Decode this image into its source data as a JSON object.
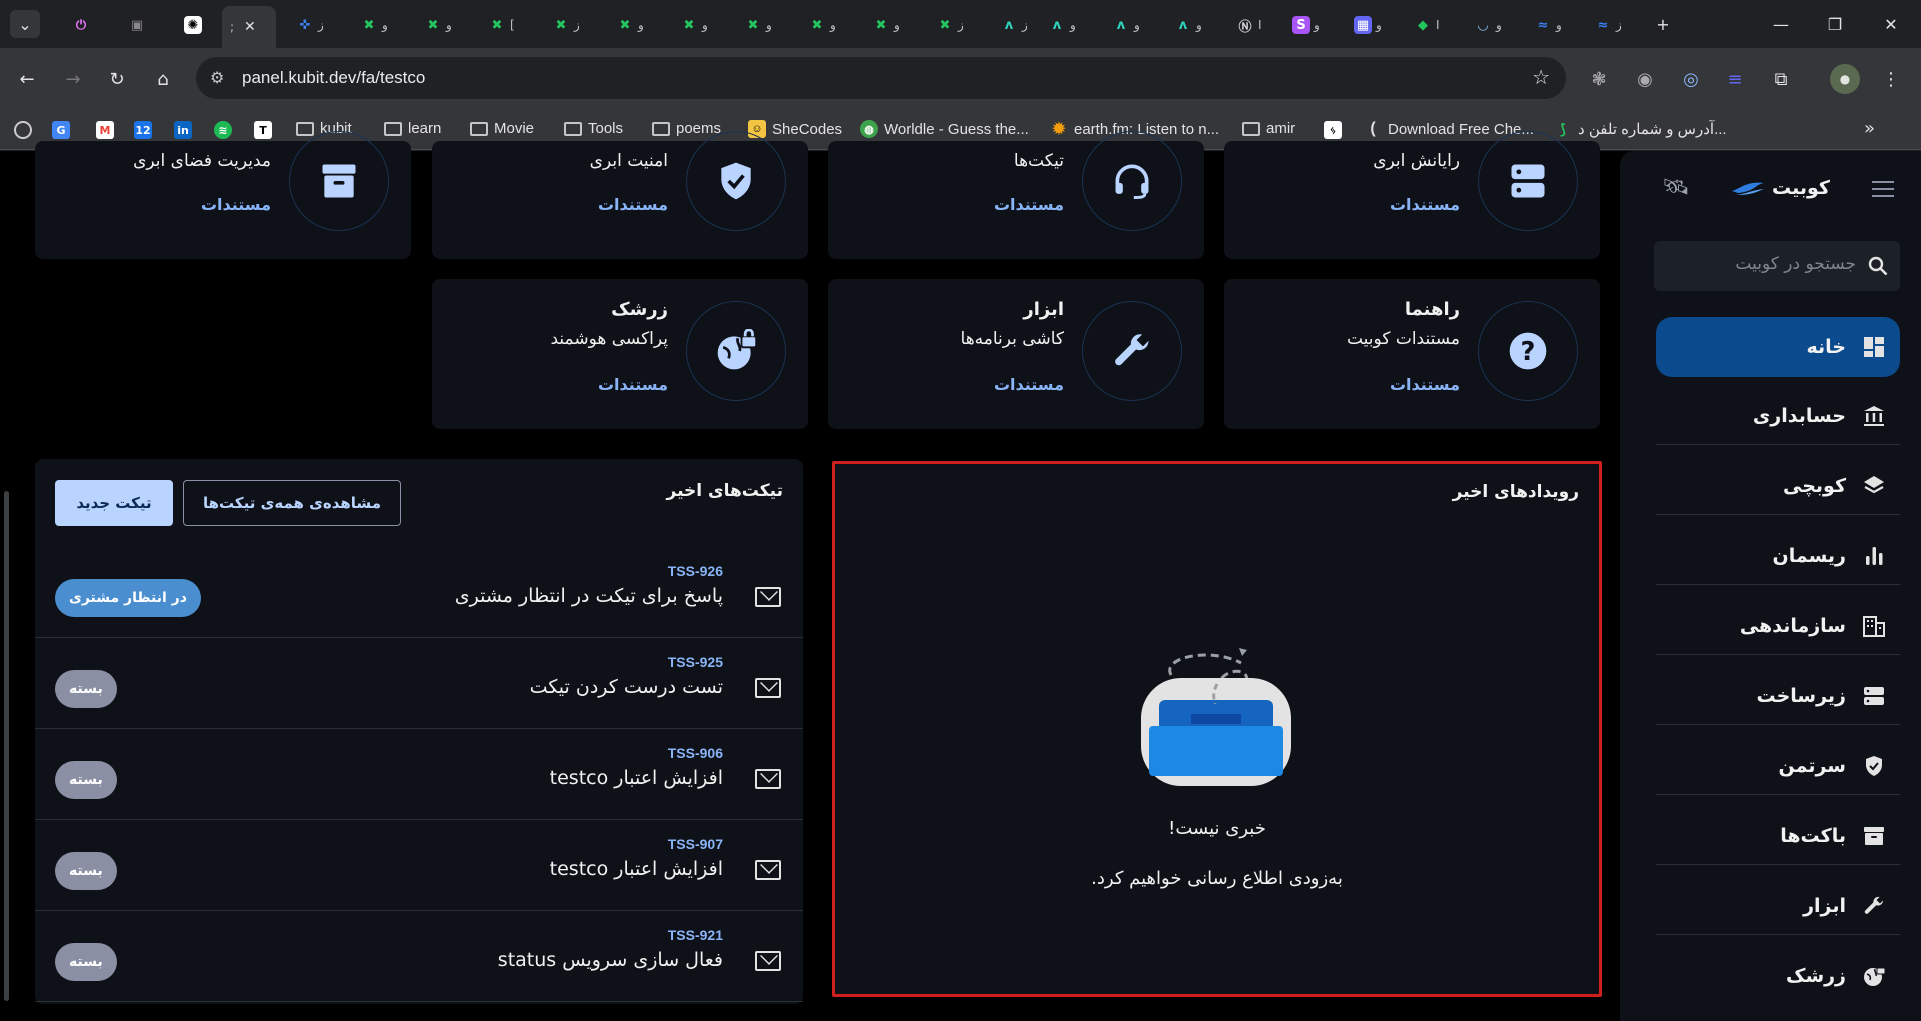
{
  "browser": {
    "url": "panel.kubit.dev/fa/testco",
    "active_tab_label": ";",
    "tab_labels": [
      "",
      "",
      ";",
      "ز",
      "و",
      "و",
      "[",
      "ز",
      "و",
      "و",
      "و",
      "و",
      "و",
      "ز",
      "ز",
      "و",
      "و",
      "و",
      "I",
      "و",
      "و",
      "I",
      "و",
      "و",
      "ز"
    ],
    "bookmarks": [
      "kubit",
      "learn",
      "Movie",
      "Tools",
      "poems",
      "SheCodes",
      "Worldle - Guess the...",
      "earth.fm: Listen to n...",
      "amir",
      "Download Free Che...",
      "آدرس و شماره تلفن د..."
    ]
  },
  "sidebar": {
    "brand": "کوبیت",
    "search_placeholder": "جستجو در کوبیت",
    "items": [
      {
        "label": "خانه",
        "icon": "dashboard-icon"
      },
      {
        "label": "حسابداری",
        "icon": "bank-icon"
      },
      {
        "label": "کوبچی",
        "icon": "layers-icon"
      },
      {
        "label": "ریسمان",
        "icon": "chart-icon"
      },
      {
        "label": "سازماندهی",
        "icon": "building-icon"
      },
      {
        "label": "زیرساخت",
        "icon": "server-icon"
      },
      {
        "label": "سرتمن",
        "icon": "shield-icon"
      },
      {
        "label": "باکت‌ها",
        "icon": "archive-icon"
      },
      {
        "label": "ابزار",
        "icon": "wrench-icon"
      },
      {
        "label": "زرشک",
        "icon": "globe-lock-icon"
      }
    ]
  },
  "services": {
    "doc_label": "مستندات",
    "row1": [
      {
        "subtitle": "رایانش ابری",
        "icon": "server-icon"
      },
      {
        "subtitle": "تیکت‌ها",
        "icon": "headset-icon"
      },
      {
        "subtitle": "امنیت ابری",
        "icon": "shield-check-icon"
      },
      {
        "subtitle": "مدیریت فضای ابری",
        "icon": "archive-icon"
      }
    ],
    "row2": [
      {
        "title": "راهنما",
        "subtitle": "مستندات کوبیت",
        "icon": "help-icon"
      },
      {
        "title": "ابزار",
        "subtitle": "کاشی برنامه‌ها",
        "icon": "wrench-icon"
      },
      {
        "title": "زرشک",
        "subtitle": "پراکسی هوشمند",
        "icon": "globe-lock-icon"
      }
    ]
  },
  "tickets": {
    "title": "تیکت‌های اخیر",
    "view_all": "مشاهده‌ی همه‌ی تیکت‌ها",
    "new_ticket": "تیکت جدید",
    "rows": [
      {
        "id": "TSS-926",
        "title": "پاسخ برای تیکت در انتظار مشتری",
        "status": "در انتظار مشتری",
        "status_color": "#4b8ed0"
      },
      {
        "id": "TSS-925",
        "title": "تست درست کردن تیکت",
        "status": "بسته",
        "status_color": "#8a8fa3"
      },
      {
        "id": "TSS-906",
        "title": "افزایش اعتبار testco",
        "status": "بسته",
        "status_color": "#8a8fa3"
      },
      {
        "id": "TSS-907",
        "title": "افزایش اعتبار testco",
        "status": "بسته",
        "status_color": "#8a8fa3"
      },
      {
        "id": "TSS-921",
        "title": "فعال سازی سرویس status",
        "status": "بسته",
        "status_color": "#8a8fa3"
      }
    ]
  },
  "events": {
    "title": "رویدادهای اخیر",
    "empty_title": "خبری نیست!",
    "empty_subtitle": "به‌زودی اطلاع رسانی خواهیم کرد."
  },
  "colors": {
    "accent": "#8ab4f8",
    "active_nav": "#0b4a8c",
    "highlight_border": "#d01f1f",
    "icon_blue": "#b9d4ff"
  }
}
